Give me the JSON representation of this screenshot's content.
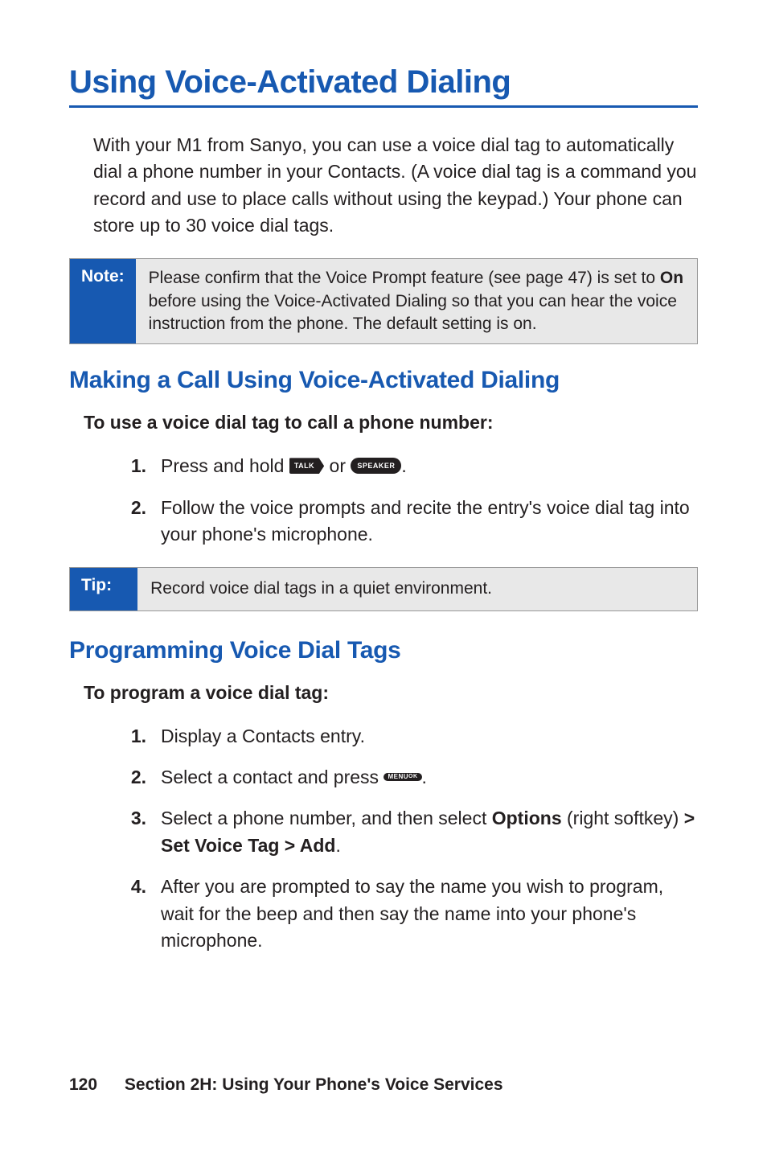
{
  "title": "Using Voice-Activated Dialing",
  "intro": "With your M1 from Sanyo, you can use a voice dial tag to automatically dial a phone number in your Contacts. (A voice dial tag is a command you record and use to place calls without using the keypad.) Your phone can store up to 30 voice dial tags.",
  "note": {
    "label": "Note:",
    "text_pre": "Please confirm that the Voice Prompt feature (see page 47) is set to ",
    "bold": "On",
    "text_post": " before using the Voice-Activated Dialing so that you can hear the voice instruction from the phone. The default setting is on."
  },
  "section1": {
    "heading": "Making a Call Using Voice-Activated Dialing",
    "subhead": "To use a voice dial tag to call a phone number:",
    "steps": {
      "s1": {
        "num": "1.",
        "pre": "Press and hold ",
        "mid": " or ",
        "post": "."
      },
      "s2": {
        "num": "2.",
        "text": "Follow the voice prompts and recite the entry's voice dial tag into your phone's microphone."
      }
    }
  },
  "tip": {
    "label": "Tip:",
    "text": "Record voice dial tags in a quiet environment."
  },
  "section2": {
    "heading": "Programming Voice Dial Tags",
    "subhead": "To program a voice dial tag:",
    "steps": {
      "s1": {
        "num": "1.",
        "text": "Display a Contacts entry."
      },
      "s2": {
        "num": "2.",
        "pre": "Select a contact and press ",
        "post": "."
      },
      "s3": {
        "num": "3.",
        "pre": "Select a phone number, and then select ",
        "b1": "Options",
        "mid1": " (right softkey) ",
        "b2": "> Set Voice Tag > Add",
        "post": "."
      },
      "s4": {
        "num": "4.",
        "text": "After you are prompted to say the name you wish to program, wait for the beep and then say the name into your phone's microphone."
      }
    }
  },
  "keys": {
    "talk": "TALK",
    "speaker": "SPEAKER",
    "menu_top": "MENU",
    "menu_bot": "OK"
  },
  "footer": {
    "page": "120",
    "section": "Section 2H: Using Your Phone's Voice Services"
  }
}
